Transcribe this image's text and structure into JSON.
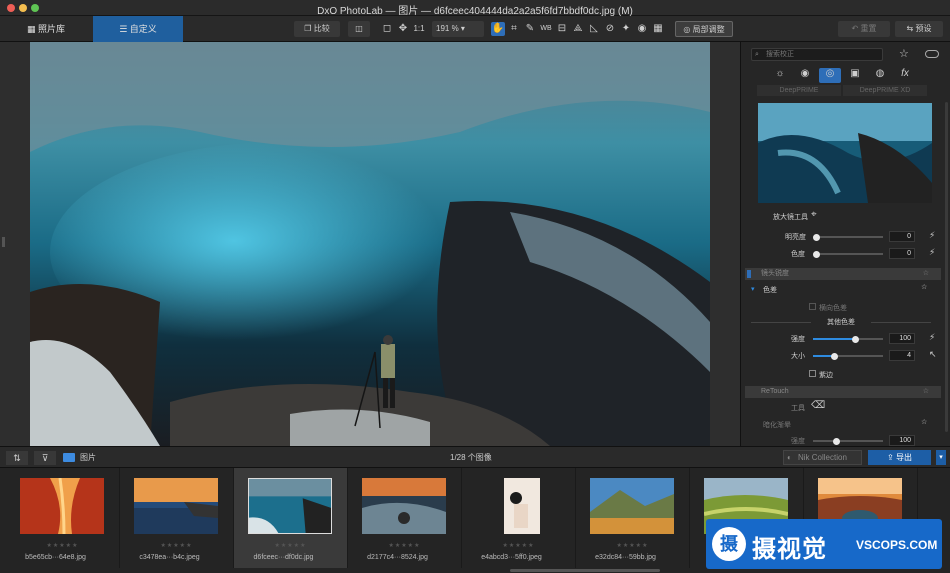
{
  "window": {
    "title": "DxO PhotoLab — 图片 — d6fceec404444da2a2a5f6fd7bbdf0dc.jpg (M)"
  },
  "tabs": {
    "library": "照片库",
    "customize": "自定义"
  },
  "toolbar": {
    "compare": "比较",
    "one_to_one": "1:1",
    "zoom": "191 %",
    "local_adjust": "局部调整",
    "redo": "重置",
    "preset": "预设"
  },
  "panel": {
    "search_placeholder": "搜索校正",
    "denoise_a": "DeepPRIME",
    "denoise_b": "DeepPRIME XD",
    "loupe": "放大镜工具",
    "brightness": {
      "label": "明亮度",
      "value": "0"
    },
    "hue": {
      "label": "色度",
      "value": "0"
    },
    "lens_section": "镜头锐度",
    "chromatic": "色差",
    "lateral": "横向色差",
    "other": "其他色差",
    "intensity": {
      "label": "强度",
      "value": "100",
      "level": 0.6
    },
    "size": {
      "label": "大小",
      "value": "4",
      "level": 0.3
    },
    "purple": "紫边",
    "retouch_section": "ReTouch",
    "tool": "工具",
    "vignette": "暗化渐晕",
    "partial": {
      "label": "强度",
      "value": "100"
    }
  },
  "filmstrip_bar": {
    "folder": "图片",
    "count": "1/28 个图像",
    "nik": "Nik Collection",
    "export": "导出"
  },
  "thumbnails": [
    {
      "name": "b5e65cb···64e8.jpg",
      "stars": "★★★★★"
    },
    {
      "name": "c3478ea···b4c.jpeg",
      "stars": "★★★★★"
    },
    {
      "name": "d6fceec···df0dc.jpg",
      "stars": "★★★★★"
    },
    {
      "name": "d2177c4···8524.jpg",
      "stars": "★★★★★"
    },
    {
      "name": "e4abcd3···5ff0.jpeg",
      "stars": "★★★★★"
    },
    {
      "name": "e32dc84···59bb.jpg",
      "stars": "★★★★★"
    },
    {
      "name": "",
      "stars": ""
    },
    {
      "name": "",
      "stars": ""
    }
  ],
  "watermark": {
    "cn": "摄视觉",
    "domain": "VSCOPS.COM",
    "logo_char": "摄"
  }
}
